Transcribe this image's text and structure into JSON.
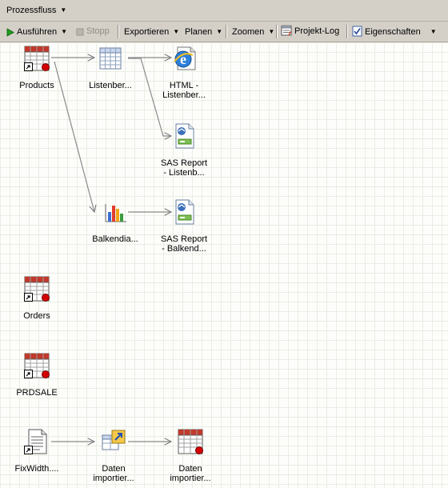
{
  "titlebar": {
    "label": "Prozessfluss"
  },
  "toolbar": {
    "run": "Ausführen",
    "stop": "Stopp",
    "export": "Exportieren",
    "schedule": "Planen",
    "zoom": "Zoomen",
    "projectlog": "Projekt-Log",
    "properties": "Eigenschaften"
  },
  "nodes": {
    "products": {
      "label": "Products"
    },
    "listenber": {
      "label": "Listenber..."
    },
    "html": {
      "line1": "HTML -",
      "line2": "Listenber..."
    },
    "sasrep1": {
      "line1": "SAS Report",
      "line2": "- Listenb..."
    },
    "balken": {
      "label": "Balkendia..."
    },
    "sasrep2": {
      "line1": "SAS Report",
      "line2": "- Balkend..."
    },
    "orders": {
      "label": "Orders"
    },
    "prdsale": {
      "label": "PRDSALE"
    },
    "fixwidth": {
      "label": "FixWidth...."
    },
    "import1": {
      "line1": "Daten",
      "line2": "importier..."
    },
    "import2": {
      "line1": "Daten",
      "line2": "importier..."
    }
  }
}
